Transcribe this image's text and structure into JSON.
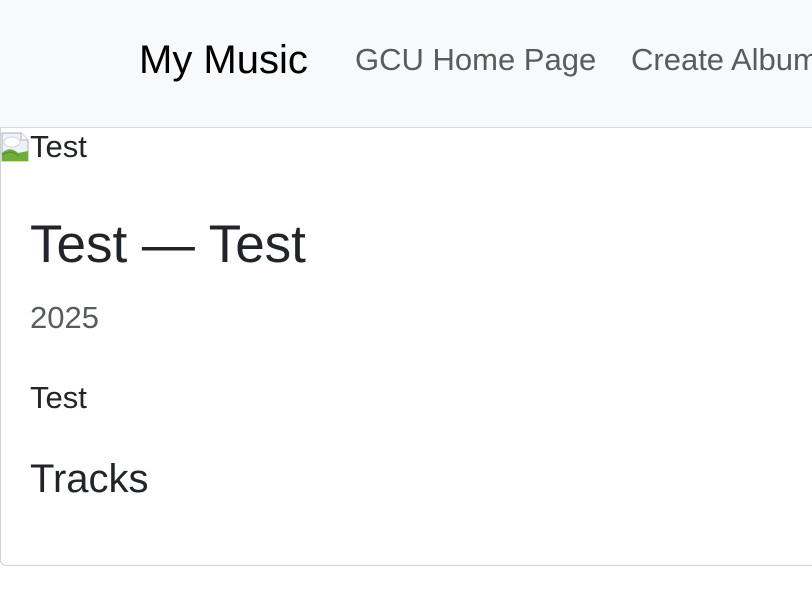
{
  "navbar": {
    "brand": "My Music",
    "links": [
      "GCU Home Page",
      "Create Album"
    ]
  },
  "album": {
    "image_alt": "Test",
    "image_icon": "broken-image-icon",
    "title": "Test — Test",
    "year": "2025",
    "description": "Test",
    "tracks_heading": "Tracks"
  },
  "colors": {
    "navbar_bg": "#f8f9fa",
    "text": "#212529",
    "muted": "#595c5f"
  }
}
